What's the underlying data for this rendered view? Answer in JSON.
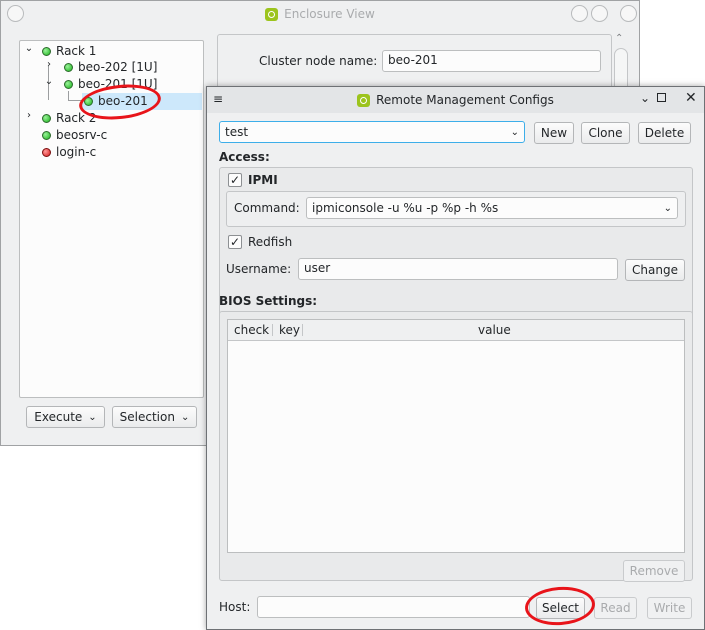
{
  "enclosure_window": {
    "title": "Enclosure View",
    "tree": {
      "rack1": "Rack 1",
      "beo202": "beo-202 [1U]",
      "beo201u": "beo-201 [1U]",
      "beo201": "beo-201",
      "rack2": "Rack 2",
      "beosrv": "beosrv-c",
      "login": "login-c"
    },
    "cluster_node_label": "Cluster node name:",
    "cluster_node_value": "beo-201",
    "execute_label": "Execute",
    "selection_label": "Selection"
  },
  "rm_window": {
    "title": "Remote Management Configs",
    "profile_value": "test",
    "new_label": "New",
    "clone_label": "Clone",
    "delete_label": "Delete",
    "access_header": "Access:",
    "ipmi_label": "IPMI",
    "ipmi_checked": "✓",
    "command_label": "Command:",
    "command_value": "ipmiconsole -u %u -p %p -h %s",
    "redfish_label": "Redfish",
    "redfish_checked": "✓",
    "username_label": "Username:",
    "username_value": "user",
    "change_label": "Change",
    "bios_header": "BIOS Settings:",
    "columns": {
      "check": "check",
      "key": "key",
      "value": "value"
    },
    "remove_label": "Remove",
    "host_label": "Host:",
    "host_value": "",
    "select_label": "Select",
    "read_label": "Read",
    "write_label": "Write"
  },
  "colors": {
    "app_icon": "#9cc41d",
    "highlight": "#e8141a",
    "selection": "#cde8fb"
  }
}
